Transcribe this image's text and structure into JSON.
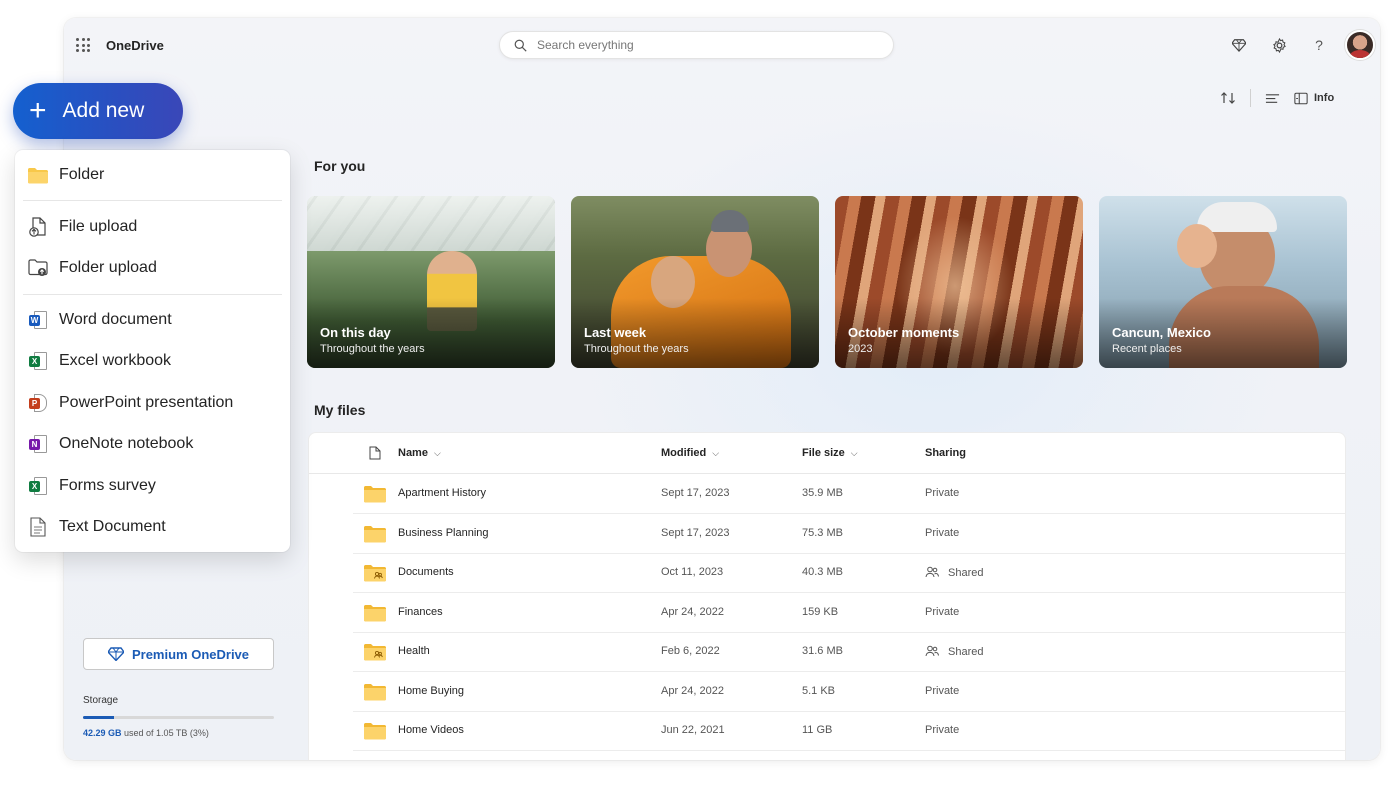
{
  "app": {
    "name": "OneDrive"
  },
  "search": {
    "placeholder": "Search everything"
  },
  "toolbar": {
    "info_label": "Info"
  },
  "add_new": {
    "label": "Add new"
  },
  "menu": {
    "items": [
      {
        "label": "Folder",
        "icon": "folder-icon"
      },
      {
        "label": "File upload",
        "icon": "file-upload-icon"
      },
      {
        "label": "Folder upload",
        "icon": "folder-upload-icon"
      },
      {
        "label": "Word document",
        "icon": "word-icon",
        "color": "#185abd"
      },
      {
        "label": "Excel workbook",
        "icon": "excel-icon",
        "color": "#107c41"
      },
      {
        "label": "PowerPoint presentation",
        "icon": "powerpoint-icon",
        "color": "#c43e1c"
      },
      {
        "label": "OneNote notebook",
        "icon": "onenote-icon",
        "color": "#7719aa"
      },
      {
        "label": "Forms survey",
        "icon": "forms-icon",
        "color": "#107c41"
      },
      {
        "label": "Text Document",
        "icon": "text-document-icon"
      }
    ]
  },
  "sidebar": {
    "premium_label": "Premium OneDrive",
    "storage_label": "Storage",
    "storage_used": "42.29 GB",
    "storage_rest": " used of 1.05 TB (3%)",
    "storage_fraction": 0.16
  },
  "for_you": {
    "title": "For you",
    "cards": [
      {
        "title": "On this day",
        "subtitle": "Throughout the years"
      },
      {
        "title": "Last week",
        "subtitle": "Throughout the years"
      },
      {
        "title": "October moments",
        "subtitle": "2023"
      },
      {
        "title": "Cancun, Mexico",
        "subtitle": "Recent places"
      }
    ]
  },
  "my_files": {
    "title": "My files",
    "columns": {
      "name": "Name",
      "modified": "Modified",
      "size": "File size",
      "sharing": "Sharing"
    },
    "rows": [
      {
        "name": "Apartment History",
        "modified": "Sept 17, 2023",
        "size": "35.9 MB",
        "sharing": "Private",
        "shared": false
      },
      {
        "name": "Business Planning",
        "modified": "Sept 17, 2023",
        "size": "75.3 MB",
        "sharing": "Private",
        "shared": false
      },
      {
        "name": "Documents",
        "modified": "Oct 11, 2023",
        "size": "40.3 MB",
        "sharing": "Shared",
        "shared": true
      },
      {
        "name": "Finances",
        "modified": "Apr 24, 2022",
        "size": "159 KB",
        "sharing": "Private",
        "shared": false
      },
      {
        "name": "Health",
        "modified": "Feb 6, 2022",
        "size": "31.6 MB",
        "sharing": "Shared",
        "shared": true
      },
      {
        "name": "Home Buying",
        "modified": "Apr 24, 2022",
        "size": "5.1 KB",
        "sharing": "Private",
        "shared": false
      },
      {
        "name": "Home Videos",
        "modified": "Jun 22, 2021",
        "size": "11 GB",
        "sharing": "Private",
        "shared": false
      }
    ]
  },
  "colors": {
    "accent": "#1b5bb5",
    "folder": "#f8c84a"
  }
}
